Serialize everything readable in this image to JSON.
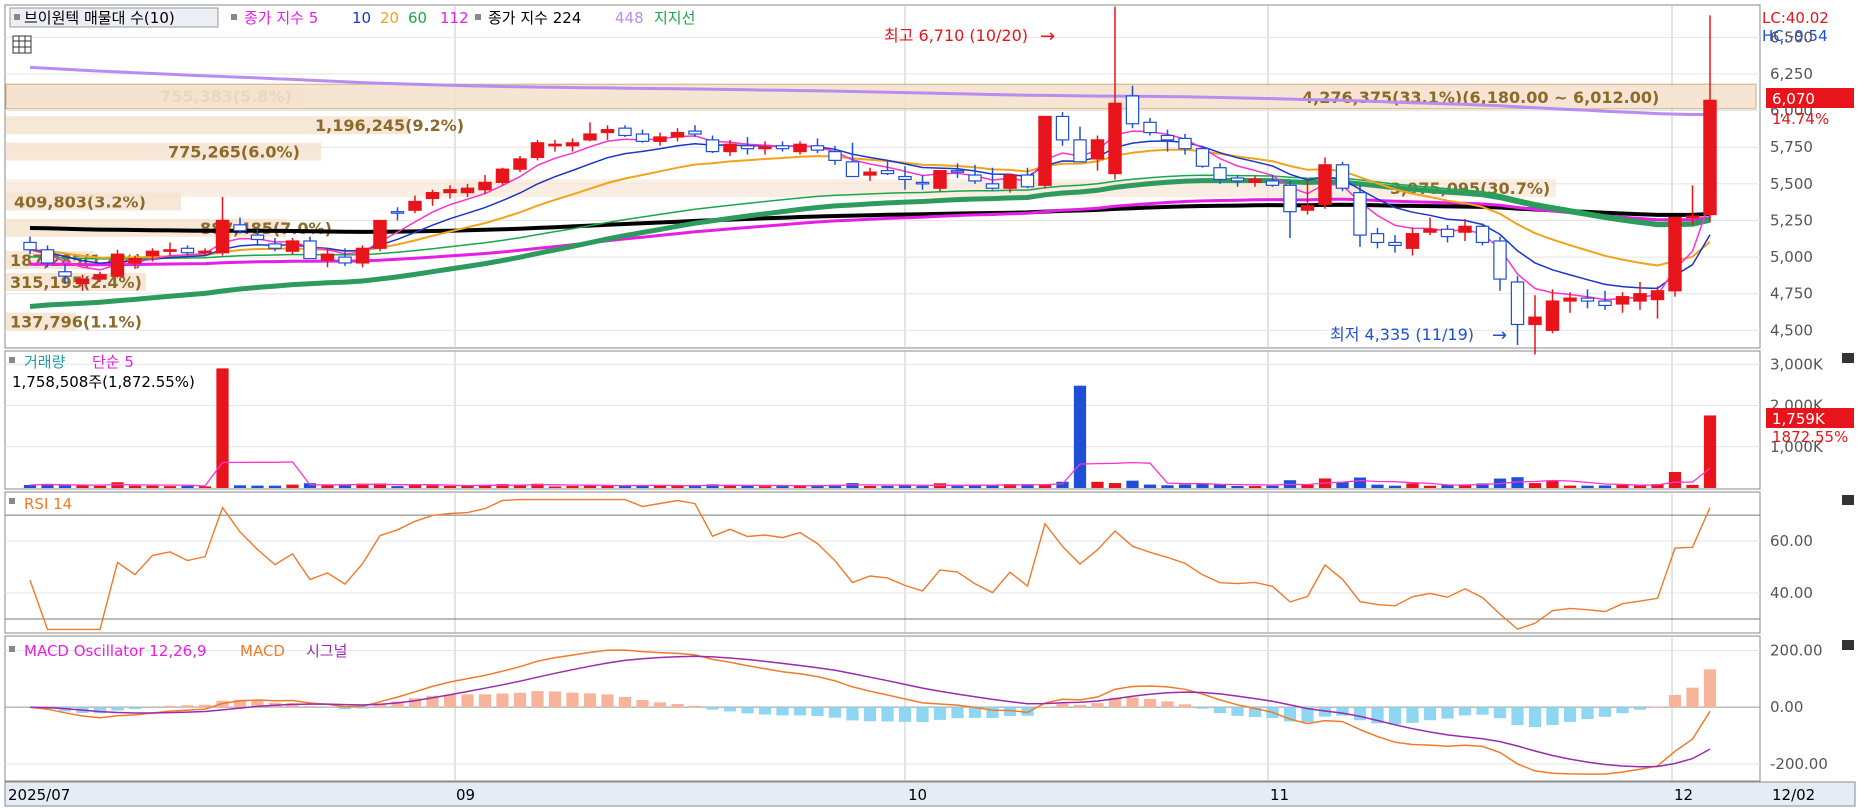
{
  "colors": {
    "up": "#e8141b",
    "down": "#1f4fd6",
    "ma5": "#ff33cc",
    "ma10": "#1a35c8",
    "ma20": "#f2a31a",
    "ma60": "#18a84a",
    "ma112": "#e61ee6",
    "ma224": "#000000",
    "ma448": "#b98cf0",
    "support_text": "#8b6a2a",
    "support_band": "#f6e3cf",
    "grid": "#c8c8c8",
    "rsi": "#f07a2a",
    "macd": "#f07a2a",
    "macd_signal": "#9b2ab0",
    "osc_pos": "#f8b49a",
    "osc_neg": "#8fd6f2",
    "lc": "#e8141b",
    "hc": "#1f4fd6"
  },
  "main_panel": {
    "legend": {
      "icon": "square-icon",
      "volume_profile_label": "브이원텍 매물대 수(10)",
      "close_ma_label": "종가 지수 5",
      "ma_periods": [
        "10",
        "20",
        "60",
        "112"
      ],
      "close_ma2_label": "종가 지수 224",
      "ma448_label": "448",
      "support_label": "지지선"
    },
    "lc_label": "LC:40.02",
    "hc_label": "HC:-9.54",
    "current_price_tag": "6,070",
    "current_change_tag": "14.74%",
    "high_annotation": "최고 6,710 (10/20)",
    "low_annotation": "최저 4,335 (11/19)",
    "y_ticks": [
      "6,500",
      "6,250",
      "6,000",
      "5,750",
      "5,500",
      "5,250",
      "5,000",
      "4,750",
      "4,500"
    ],
    "volume_profile_labels": [
      "755,383(5.8%)",
      "1,196,245(9.2%)",
      "775,265(6.0%)",
      "409,803(3.2%)",
      "887,485(7.0%)",
      "187,285(1.4%)",
      "315,195(2.4%)",
      "137,796(1.1%)",
      "4,276,375(33.1%)(6,180.00 ~ 6,012.00)",
      "3,975,095(30.7%)"
    ]
  },
  "volume_panel": {
    "title": "거래량",
    "ma_label": "단순 5",
    "readout": "1,758,508주(1,872.55%)",
    "y_ticks": [
      "3,000K",
      "2,000K",
      "1,000K"
    ],
    "current_tag": "1,759K",
    "current_pct_tag": "1872.55%"
  },
  "rsi_panel": {
    "title": "RSI 14",
    "y_ticks": [
      "60.00",
      "40.00"
    ]
  },
  "macd_panel": {
    "title": "MACD Oscillator 12,26,9",
    "macd_label": "MACD",
    "signal_label": "시그널",
    "y_ticks": [
      "200.00",
      "0.00",
      "-200.00"
    ]
  },
  "x_axis": {
    "labels": [
      "2025/07",
      "09",
      "10",
      "11",
      "12",
      "12/02"
    ]
  },
  "chart_data": {
    "type": "candlestick",
    "price_range": [
      4400,
      6550
    ],
    "high": 6710,
    "low": 4335,
    "candles": [
      {
        "o": 5100,
        "h": 5140,
        "l": 5020,
        "c": 5050
      },
      {
        "o": 5050,
        "h": 5080,
        "l": 4930,
        "c": 4960
      },
      {
        "o": 4900,
        "h": 4950,
        "l": 4820,
        "c": 4870
      },
      {
        "o": 4820,
        "h": 4880,
        "l": 4770,
        "c": 4850
      },
      {
        "o": 4850,
        "h": 4900,
        "l": 4830,
        "c": 4880
      },
      {
        "o": 4870,
        "h": 5050,
        "l": 4860,
        "c": 5020
      },
      {
        "o": 4960,
        "h": 5010,
        "l": 4920,
        "c": 4990
      },
      {
        "o": 5010,
        "h": 5060,
        "l": 4970,
        "c": 5040
      },
      {
        "o": 5040,
        "h": 5100,
        "l": 5010,
        "c": 5050
      },
      {
        "o": 5060,
        "h": 5080,
        "l": 5010,
        "c": 5030
      },
      {
        "o": 5030,
        "h": 5060,
        "l": 5010,
        "c": 5040
      },
      {
        "o": 5030,
        "h": 5410,
        "l": 5010,
        "c": 5250
      },
      {
        "o": 5220,
        "h": 5270,
        "l": 5160,
        "c": 5180
      },
      {
        "o": 5150,
        "h": 5190,
        "l": 5090,
        "c": 5120
      },
      {
        "o": 5090,
        "h": 5130,
        "l": 5040,
        "c": 5060
      },
      {
        "o": 5040,
        "h": 5130,
        "l": 5020,
        "c": 5110
      },
      {
        "o": 5110,
        "h": 5140,
        "l": 4990,
        "c": 4990
      },
      {
        "o": 4980,
        "h": 5060,
        "l": 4930,
        "c": 5020
      },
      {
        "o": 5000,
        "h": 5060,
        "l": 4940,
        "c": 4960
      },
      {
        "o": 4960,
        "h": 5080,
        "l": 4930,
        "c": 5060
      },
      {
        "o": 5060,
        "h": 5250,
        "l": 5040,
        "c": 5250
      },
      {
        "o": 5310,
        "h": 5340,
        "l": 5250,
        "c": 5300
      },
      {
        "o": 5320,
        "h": 5420,
        "l": 5300,
        "c": 5380
      },
      {
        "o": 5400,
        "h": 5460,
        "l": 5350,
        "c": 5440
      },
      {
        "o": 5440,
        "h": 5490,
        "l": 5400,
        "c": 5460
      },
      {
        "o": 5440,
        "h": 5500,
        "l": 5410,
        "c": 5470
      },
      {
        "o": 5460,
        "h": 5560,
        "l": 5430,
        "c": 5510
      },
      {
        "o": 5510,
        "h": 5610,
        "l": 5490,
        "c": 5600
      },
      {
        "o": 5600,
        "h": 5690,
        "l": 5580,
        "c": 5670
      },
      {
        "o": 5680,
        "h": 5800,
        "l": 5660,
        "c": 5780
      },
      {
        "o": 5770,
        "h": 5800,
        "l": 5720,
        "c": 5770
      },
      {
        "o": 5760,
        "h": 5810,
        "l": 5720,
        "c": 5780
      },
      {
        "o": 5800,
        "h": 5920,
        "l": 5790,
        "c": 5840
      },
      {
        "o": 5850,
        "h": 5900,
        "l": 5800,
        "c": 5870
      },
      {
        "o": 5880,
        "h": 5900,
        "l": 5820,
        "c": 5830
      },
      {
        "o": 5840,
        "h": 5870,
        "l": 5780,
        "c": 5790
      },
      {
        "o": 5790,
        "h": 5850,
        "l": 5760,
        "c": 5820
      },
      {
        "o": 5820,
        "h": 5880,
        "l": 5790,
        "c": 5850
      },
      {
        "o": 5860,
        "h": 5900,
        "l": 5820,
        "c": 5840
      },
      {
        "o": 5800,
        "h": 5830,
        "l": 5710,
        "c": 5720
      },
      {
        "o": 5720,
        "h": 5800,
        "l": 5690,
        "c": 5770
      },
      {
        "o": 5760,
        "h": 5820,
        "l": 5700,
        "c": 5740
      },
      {
        "o": 5740,
        "h": 5790,
        "l": 5700,
        "c": 5750
      },
      {
        "o": 5760,
        "h": 5790,
        "l": 5720,
        "c": 5740
      },
      {
        "o": 5720,
        "h": 5790,
        "l": 5700,
        "c": 5770
      },
      {
        "o": 5760,
        "h": 5810,
        "l": 5710,
        "c": 5730
      },
      {
        "o": 5720,
        "h": 5760,
        "l": 5630,
        "c": 5660
      },
      {
        "o": 5650,
        "h": 5780,
        "l": 5550,
        "c": 5550
      },
      {
        "o": 5560,
        "h": 5610,
        "l": 5520,
        "c": 5580
      },
      {
        "o": 5590,
        "h": 5660,
        "l": 5560,
        "c": 5570
      },
      {
        "o": 5550,
        "h": 5620,
        "l": 5460,
        "c": 5530
      },
      {
        "o": 5510,
        "h": 5560,
        "l": 5460,
        "c": 5500
      },
      {
        "o": 5470,
        "h": 5590,
        "l": 5450,
        "c": 5590
      },
      {
        "o": 5590,
        "h": 5640,
        "l": 5540,
        "c": 5580
      },
      {
        "o": 5560,
        "h": 5630,
        "l": 5500,
        "c": 5520
      },
      {
        "o": 5500,
        "h": 5610,
        "l": 5460,
        "c": 5470
      },
      {
        "o": 5470,
        "h": 5570,
        "l": 5440,
        "c": 5560
      },
      {
        "o": 5560,
        "h": 5610,
        "l": 5470,
        "c": 5480
      },
      {
        "o": 5490,
        "h": 5960,
        "l": 5470,
        "c": 5960
      },
      {
        "o": 5960,
        "h": 5990,
        "l": 5760,
        "c": 5800
      },
      {
        "o": 5800,
        "h": 5890,
        "l": 5650,
        "c": 5650
      },
      {
        "o": 5670,
        "h": 5830,
        "l": 5590,
        "c": 5800
      },
      {
        "o": 5570,
        "h": 6710,
        "l": 5530,
        "c": 6050
      },
      {
        "o": 6100,
        "h": 6170,
        "l": 5880,
        "c": 5910
      },
      {
        "o": 5920,
        "h": 5950,
        "l": 5830,
        "c": 5850
      },
      {
        "o": 5830,
        "h": 5870,
        "l": 5720,
        "c": 5800
      },
      {
        "o": 5810,
        "h": 5840,
        "l": 5700,
        "c": 5740
      },
      {
        "o": 5740,
        "h": 5760,
        "l": 5610,
        "c": 5620
      },
      {
        "o": 5610,
        "h": 5640,
        "l": 5500,
        "c": 5530
      },
      {
        "o": 5540,
        "h": 5560,
        "l": 5480,
        "c": 5520
      },
      {
        "o": 5510,
        "h": 5550,
        "l": 5480,
        "c": 5530
      },
      {
        "o": 5520,
        "h": 5560,
        "l": 5480,
        "c": 5490
      },
      {
        "o": 5490,
        "h": 5520,
        "l": 5130,
        "c": 5310
      },
      {
        "o": 5320,
        "h": 5530,
        "l": 5290,
        "c": 5350
      },
      {
        "o": 5360,
        "h": 5680,
        "l": 5330,
        "c": 5630
      },
      {
        "o": 5630,
        "h": 5650,
        "l": 5450,
        "c": 5470
      },
      {
        "o": 5440,
        "h": 5490,
        "l": 5070,
        "c": 5150
      },
      {
        "o": 5160,
        "h": 5200,
        "l": 5060,
        "c": 5100
      },
      {
        "o": 5100,
        "h": 5150,
        "l": 5030,
        "c": 5080
      },
      {
        "o": 5060,
        "h": 5200,
        "l": 5010,
        "c": 5160
      },
      {
        "o": 5170,
        "h": 5270,
        "l": 5150,
        "c": 5190
      },
      {
        "o": 5190,
        "h": 5220,
        "l": 5100,
        "c": 5140
      },
      {
        "o": 5170,
        "h": 5260,
        "l": 5110,
        "c": 5210
      },
      {
        "o": 5210,
        "h": 5230,
        "l": 5080,
        "c": 5100
      },
      {
        "o": 5110,
        "h": 5140,
        "l": 4770,
        "c": 4850
      },
      {
        "o": 4830,
        "h": 4870,
        "l": 4400,
        "c": 4540
      },
      {
        "o": 4540,
        "h": 4740,
        "l": 4335,
        "c": 4590
      },
      {
        "o": 4500,
        "h": 4780,
        "l": 4480,
        "c": 4700
      },
      {
        "o": 4700,
        "h": 4760,
        "l": 4620,
        "c": 4720
      },
      {
        "o": 4720,
        "h": 4780,
        "l": 4650,
        "c": 4700
      },
      {
        "o": 4700,
        "h": 4770,
        "l": 4640,
        "c": 4670
      },
      {
        "o": 4680,
        "h": 4760,
        "l": 4620,
        "c": 4730
      },
      {
        "o": 4700,
        "h": 4830,
        "l": 4640,
        "c": 4750
      },
      {
        "o": 4710,
        "h": 4800,
        "l": 4580,
        "c": 4770
      },
      {
        "o": 4770,
        "h": 5270,
        "l": 4730,
        "c": 5270
      },
      {
        "o": 5270,
        "h": 5490,
        "l": 5220,
        "c": 5280
      },
      {
        "o": 5290,
        "h": 6650,
        "l": 5240,
        "c": 6070
      }
    ],
    "volume_profile_pct": [
      5.8,
      9.2,
      6.0,
      3.2,
      7.0,
      1.4,
      2.4,
      1.1,
      33.1,
      30.7
    ]
  }
}
